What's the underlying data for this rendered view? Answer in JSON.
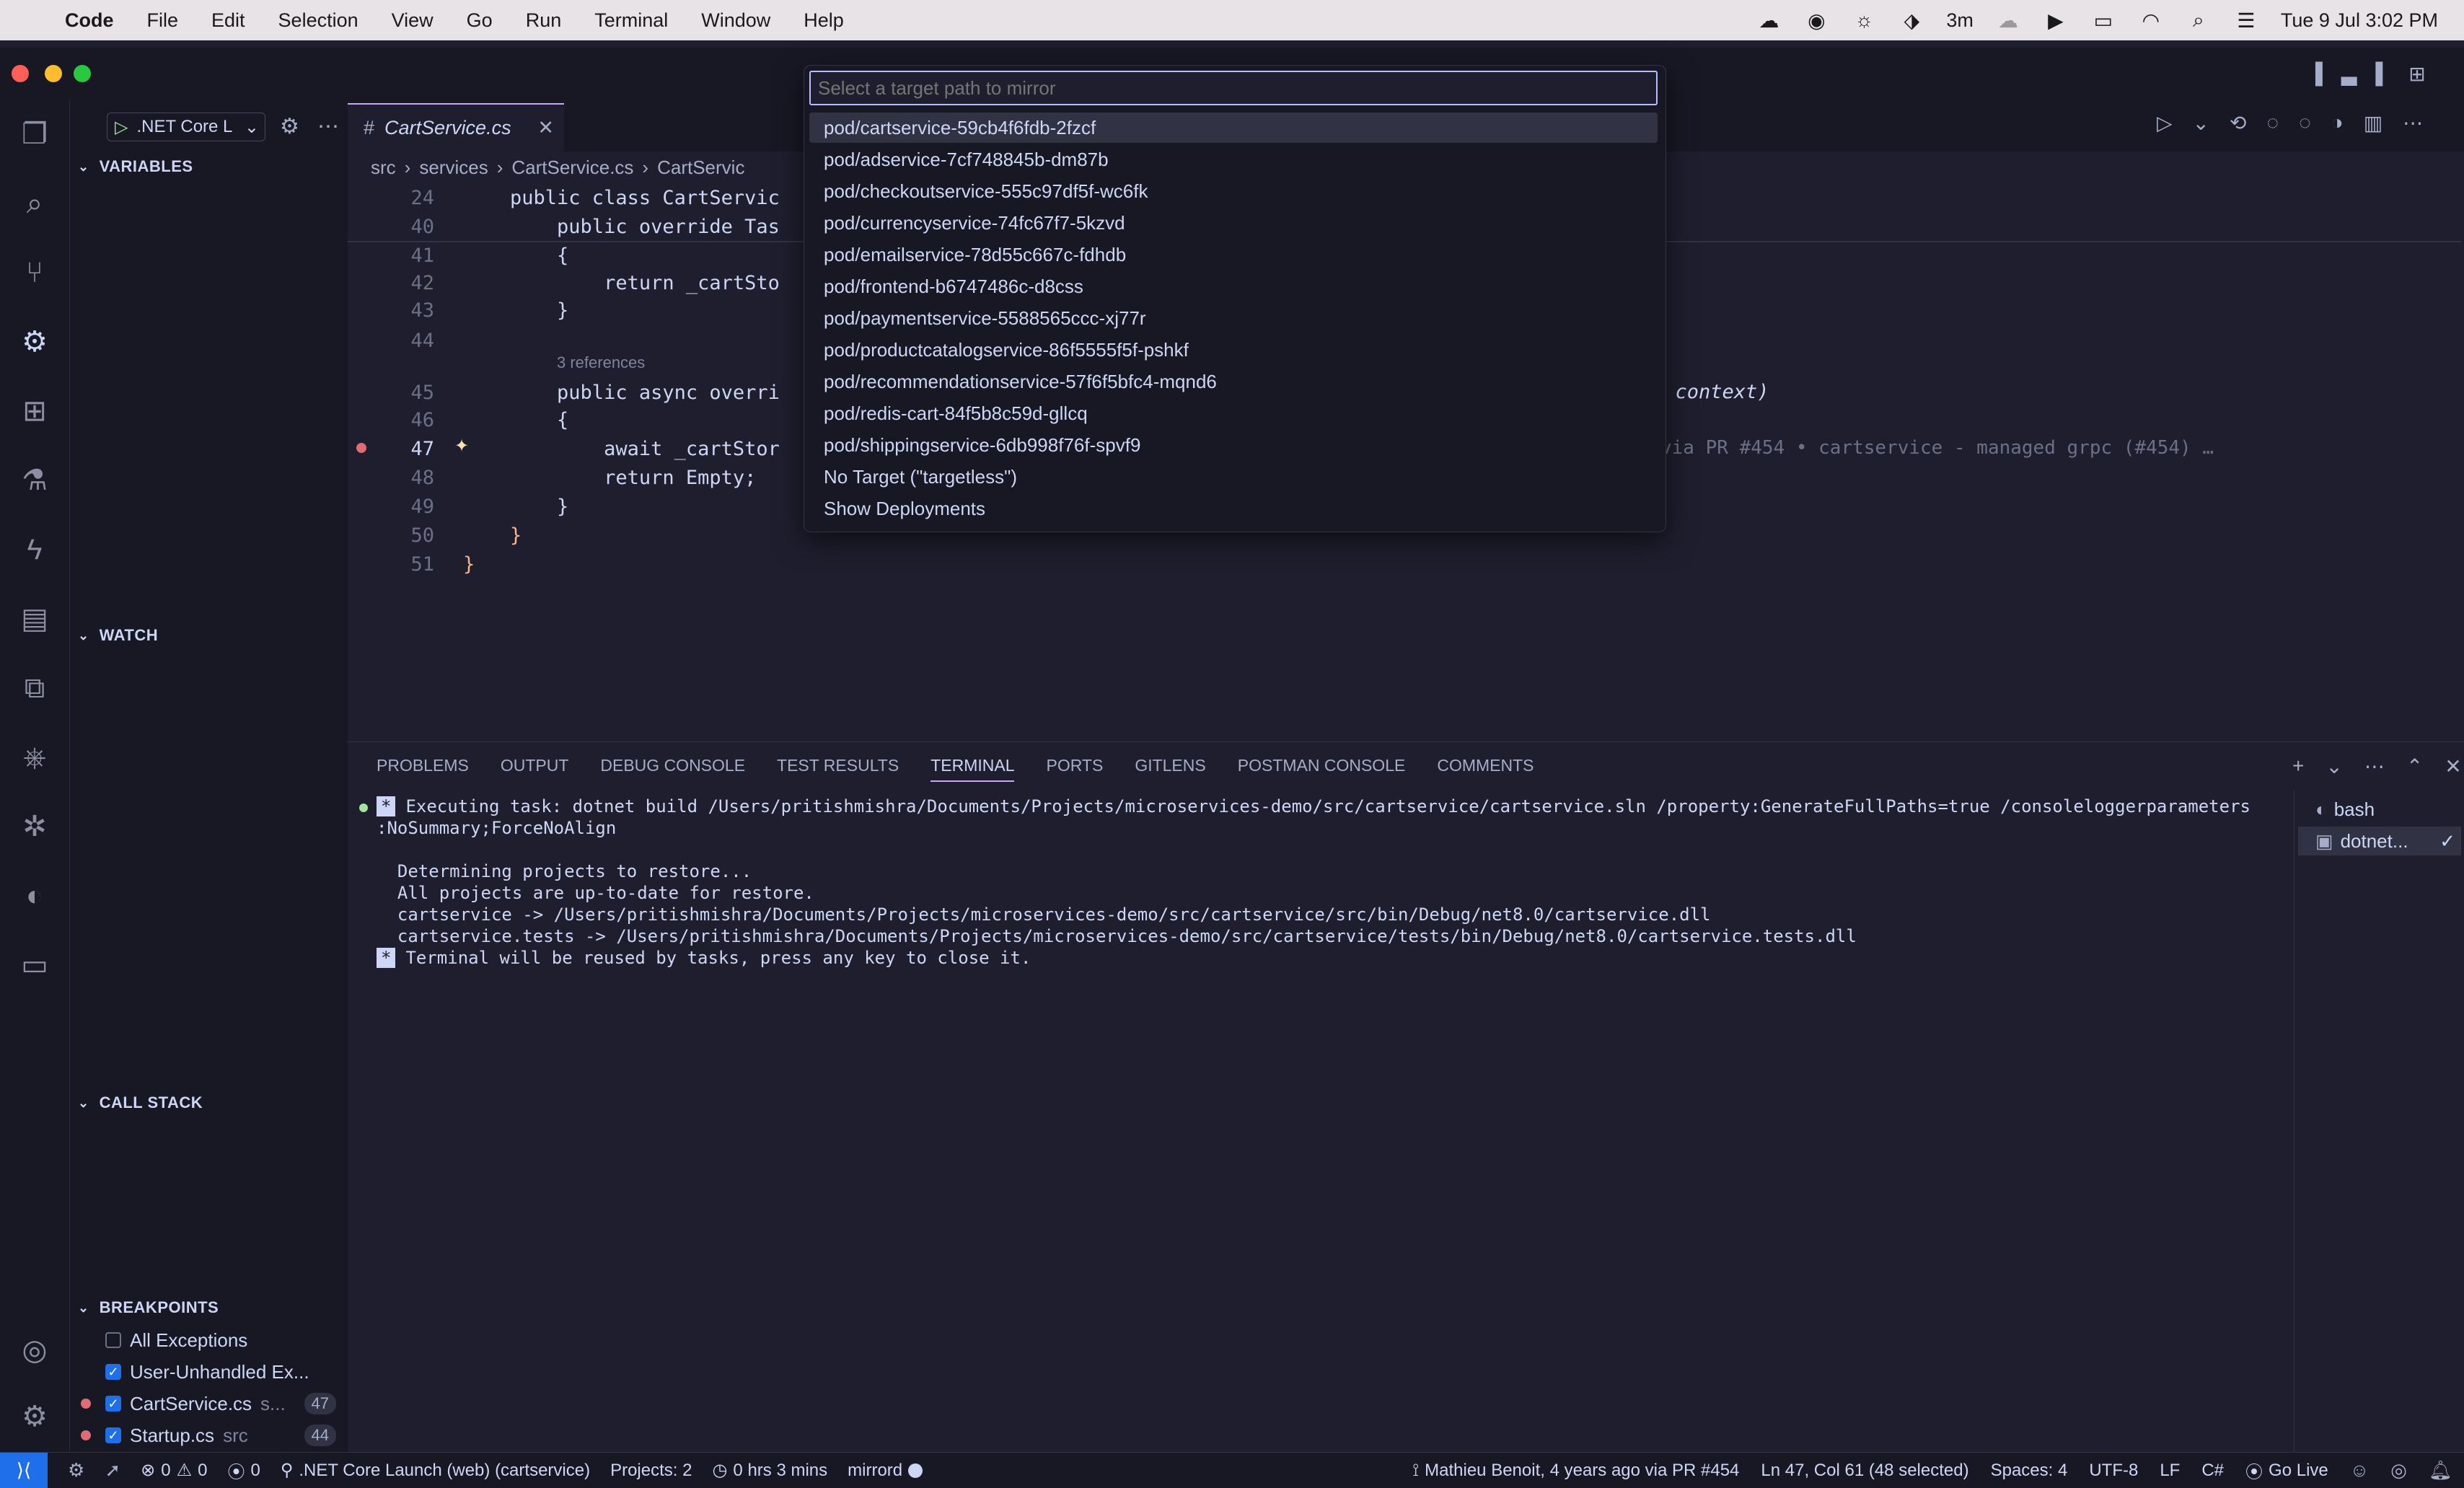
{
  "menubar": {
    "apple": "",
    "items": [
      "Code",
      "File",
      "Edit",
      "Selection",
      "View",
      "Go",
      "Run",
      "Terminal",
      "Window",
      "Help"
    ],
    "status_time_remaining": "3m",
    "clock": "Tue 9 Jul  3:02 PM"
  },
  "sidebar": {
    "run_config": ".NET Core L",
    "sections": {
      "variables": "VARIABLES",
      "watch": "WATCH",
      "call_stack": "CALL STACK",
      "breakpoints": "BREAKPOINTS"
    },
    "breakpoints": [
      {
        "label": "All Exceptions",
        "checked": false,
        "detail": "",
        "count": ""
      },
      {
        "label": "User-Unhandled Ex...",
        "checked": true,
        "detail": "",
        "count": ""
      },
      {
        "label": "CartService.cs",
        "checked": true,
        "detail": "s...",
        "count": "47"
      },
      {
        "label": "Startup.cs",
        "checked": true,
        "detail": "src",
        "count": "44"
      }
    ]
  },
  "editor": {
    "tab_label": "CartService.cs",
    "breadcrumb": [
      "src",
      "services",
      "CartService.cs",
      "CartServic"
    ],
    "code_lens": "3 references",
    "inline_blame": "via PR #454 • cartservice - managed grpc (#454) …",
    "lines": [
      {
        "n": "24",
        "text": "    public class CartServic"
      },
      {
        "n": "40",
        "text": "        public override Tas"
      },
      {
        "n": "41",
        "text": "        {"
      },
      {
        "n": "42",
        "text": "            return _cartSto"
      },
      {
        "n": "43",
        "text": "        }"
      },
      {
        "n": "44",
        "text": ""
      },
      {
        "n": "45",
        "text": "        public async overri"
      },
      {
        "n": "46",
        "text": "        {"
      },
      {
        "n": "47",
        "text": "            await _cartStor"
      },
      {
        "n": "48",
        "text": "            return Empty;"
      },
      {
        "n": "49",
        "text": "        }"
      },
      {
        "n": "50",
        "text": "    }"
      },
      {
        "n": "51",
        "text": "}"
      }
    ],
    "line45_tail": "t context)"
  },
  "palette": {
    "placeholder": "Select a target path to mirror",
    "items": [
      "pod/cartservice-59cb4f6fdb-2fzcf",
      "pod/adservice-7cf748845b-dm87b",
      "pod/checkoutservice-555c97df5f-wc6fk",
      "pod/currencyservice-74fc67f7-5kzvd",
      "pod/emailservice-78d55c667c-fdhdb",
      "pod/frontend-b6747486c-d8css",
      "pod/paymentservice-5588565ccc-xj77r",
      "pod/productcatalogservice-86f5555f5f-pshkf",
      "pod/recommendationservice-57f6f5bfc4-mqnd6",
      "pod/redis-cart-84f5b8c59d-gllcq",
      "pod/shippingservice-6db998f76f-spvf9",
      "No Target (\"targetless\")",
      "Show Deployments"
    ]
  },
  "panel": {
    "tabs": [
      "PROBLEMS",
      "OUTPUT",
      "DEBUG CONSOLE",
      "TEST RESULTS",
      "TERMINAL",
      "PORTS",
      "GITLENS",
      "POSTMAN CONSOLE",
      "COMMENTS"
    ],
    "active_tab": "TERMINAL",
    "terminal_lines": [
      "Executing task: dotnet build /Users/pritishmishra/Documents/Projects/microservices-demo/src/cartservice/cartservice.sln /property:GenerateFullPaths=true /consoleloggerparameters",
      ":NoSummary;ForceNoAlign",
      "",
      "  Determining projects to restore...",
      "  All projects are up-to-date for restore.",
      "  cartservice -> /Users/pritishmishra/Documents/Projects/microservices-demo/src/cartservice/src/bin/Debug/net8.0/cartservice.dll",
      "  cartservice.tests -> /Users/pritishmishra/Documents/Projects/microservices-demo/src/cartservice/tests/bin/Debug/net8.0/cartservice.tests.dll",
      "Terminal will be reused by tasks, press any key to close it."
    ],
    "terminals": [
      "bash",
      "dotnet..."
    ]
  },
  "statusbar": {
    "errors": "0",
    "warnings": "0",
    "ports": "0",
    "launch": ".NET Core Launch (web) (cartservice)",
    "projects": "Projects: 2",
    "time": "0 hrs 3 mins",
    "mirrord": "mirrord",
    "blame": "Mathieu Benoit, 4 years ago via PR #454",
    "position": "Ln 47, Col 61 (48 selected)",
    "spaces": "Spaces: 4",
    "encoding": "UTF-8",
    "eol": "LF",
    "language": "C#",
    "golive": "Go Live"
  },
  "colors": {
    "accent": "#cba6f7",
    "remote": "#1f6feb",
    "breakpoint": "#e06c75"
  }
}
